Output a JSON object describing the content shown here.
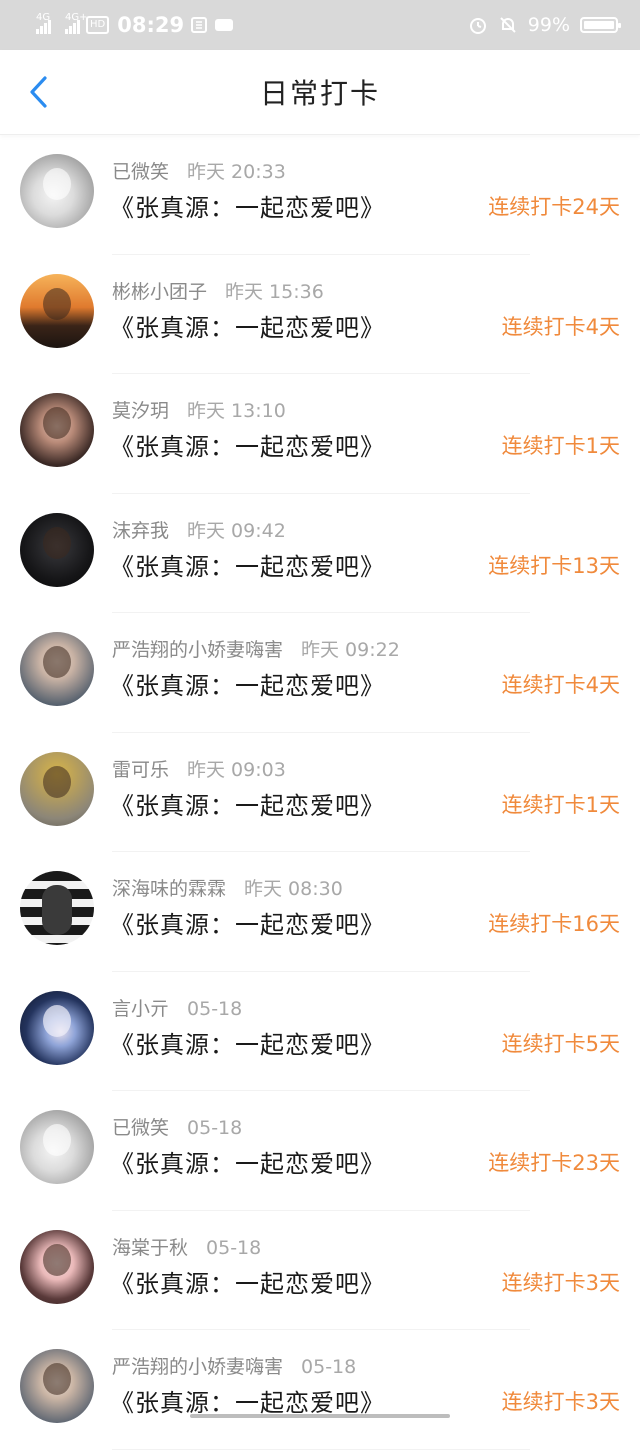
{
  "status_bar": {
    "signal1": "4G",
    "signal2": "4G+",
    "hd": "HD",
    "time": "08:29",
    "battery_percent": "99%",
    "battery_level": 0.99
  },
  "nav": {
    "title": "日常打卡"
  },
  "items": [
    {
      "name": "已微笑",
      "time": "昨天  20:33",
      "content": "《张真源：一起恋爱吧》",
      "streak": "连续打卡24天"
    },
    {
      "name": "彬彬小团子",
      "time": "昨天  15:36",
      "content": "《张真源：一起恋爱吧》",
      "streak": "连续打卡4天"
    },
    {
      "name": "莫汐玥",
      "time": "昨天  13:10",
      "content": "《张真源：一起恋爱吧》",
      "streak": "连续打卡1天"
    },
    {
      "name": "沫弃我",
      "time": "昨天  09:42",
      "content": "《张真源：一起恋爱吧》",
      "streak": "连续打卡13天"
    },
    {
      "name": "严浩翔的小娇妻嗨害",
      "time": "昨天  09:22",
      "content": "《张真源：一起恋爱吧》",
      "streak": "连续打卡4天"
    },
    {
      "name": "雷可乐",
      "time": "昨天  09:03",
      "content": "《张真源：一起恋爱吧》",
      "streak": "连续打卡1天"
    },
    {
      "name": "深海味的霖霖",
      "time": "昨天  08:30",
      "content": "《张真源：一起恋爱吧》",
      "streak": "连续打卡16天"
    },
    {
      "name": "言小亓",
      "time": "05-18",
      "content": "《张真源：一起恋爱吧》",
      "streak": "连续打卡5天"
    },
    {
      "name": "已微笑",
      "time": "05-18",
      "content": "《张真源：一起恋爱吧》",
      "streak": "连续打卡23天"
    },
    {
      "name": "海棠于秋",
      "time": "05-18",
      "content": "《张真源：一起恋爱吧》",
      "streak": "连续打卡3天"
    },
    {
      "name": "严浩翔的小娇妻嗨害",
      "time": "05-18",
      "content": "《张真源：一起恋爱吧》",
      "streak": "连续打卡3天"
    }
  ],
  "colors": {
    "accent_back": "#2b8cf0",
    "streak": "#f08a3c"
  },
  "icons": [
    "back-arrow-icon",
    "alarm-icon",
    "mute-bell-icon",
    "battery-icon",
    "signal-icon",
    "sim-card-icon",
    "app-icon"
  ]
}
